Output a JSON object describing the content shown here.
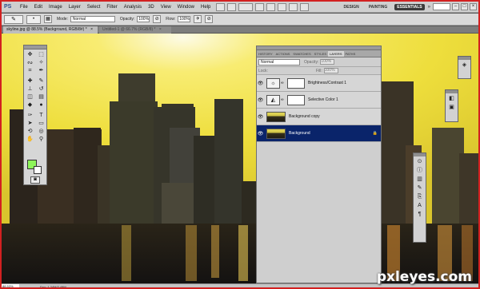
{
  "app": {
    "logo": "PS"
  },
  "menu": [
    "File",
    "Edit",
    "Image",
    "Layer",
    "Select",
    "Filter",
    "Analysis",
    "3D",
    "View",
    "Window",
    "Help"
  ],
  "menubar_icons": [
    "bridge-icon",
    "minibridge-icon",
    "zoom-level-icon",
    "hand-icon",
    "zoom-icon",
    "rotate-icon",
    "arrange-icon",
    "screen-mode-icon"
  ],
  "workspaces": {
    "design": "DESIGN",
    "painting": "PAINTING",
    "essentials": "ESSENTIALS",
    "more": "»"
  },
  "window_buttons": {
    "minimize": "–",
    "restore": "□",
    "close": "×"
  },
  "options": {
    "tool_glyph": "✎",
    "mode_label": "Mode:",
    "mode_value": "Normal",
    "opacity_label": "Opacity:",
    "opacity_value": "100%",
    "flow_label": "Flow:",
    "flow_value": "100%"
  },
  "tabs": [
    {
      "label": "skyline.jpg @ 88.5% (Background, RGB/8#) *",
      "close": "×"
    },
    {
      "label": "Untitled-1 @ 66.7% (RGB/8) *",
      "close": "×"
    }
  ],
  "toolbox": {
    "tools": [
      {
        "name": "move-tool",
        "glyph": "✥"
      },
      {
        "name": "marquee-tool",
        "glyph": "⬚"
      },
      {
        "name": "lasso-tool",
        "glyph": "ᔓ"
      },
      {
        "name": "quick-select-tool",
        "glyph": "✧"
      },
      {
        "name": "crop-tool",
        "glyph": "⌗"
      },
      {
        "name": "eyedropper-tool",
        "glyph": "✒"
      },
      {
        "name": "healing-brush-tool",
        "glyph": "✚"
      },
      {
        "name": "brush-tool",
        "glyph": "✎"
      },
      {
        "name": "clone-stamp-tool",
        "glyph": "⊥"
      },
      {
        "name": "history-brush-tool",
        "glyph": "↺"
      },
      {
        "name": "eraser-tool",
        "glyph": "◫"
      },
      {
        "name": "gradient-tool",
        "glyph": "▤"
      },
      {
        "name": "blur-tool",
        "glyph": "◆"
      },
      {
        "name": "dodge-tool",
        "glyph": "●"
      },
      {
        "name": "pen-tool",
        "glyph": "✑"
      },
      {
        "name": "type-tool",
        "glyph": "T"
      },
      {
        "name": "path-select-tool",
        "glyph": "➤"
      },
      {
        "name": "shape-tool",
        "glyph": "▭"
      },
      {
        "name": "3d-rotate-tool",
        "glyph": "⟲"
      },
      {
        "name": "3d-orbit-tool",
        "glyph": "◎"
      },
      {
        "name": "hand-tool",
        "glyph": "✋"
      },
      {
        "name": "zoom-tool",
        "glyph": "⚲"
      }
    ],
    "quickmask_glyph": "◙",
    "foreground_color": "#8ef55a",
    "background_color": "#ffffff"
  },
  "layers_panel": {
    "tabs": [
      "HISTORY",
      "ACTIONS",
      "SWATCHES",
      "STYLES",
      "LAYERS",
      "PATHS"
    ],
    "blend_mode": "Normal",
    "opacity_label": "Opacity:",
    "opacity_value": "100%",
    "lock_label": "Lock:",
    "fill_label": "Fill:",
    "fill_value": "100%",
    "layers": [
      {
        "name": "Brightness/Contrast 1",
        "type": "adjustment",
        "glyph": "☼",
        "visible_glyph": "👁",
        "selected": false
      },
      {
        "name": "Selective Color 1",
        "type": "adjustment",
        "glyph": "◭",
        "visible_glyph": "👁",
        "selected": false
      },
      {
        "name": "Background copy",
        "type": "image",
        "visible_glyph": "👁",
        "selected": false
      },
      {
        "name": "Background",
        "type": "image",
        "visible_glyph": "👁",
        "selected": true,
        "lock_glyph": "🔒"
      }
    ]
  },
  "docks": {
    "dock1": [
      "3d-icon"
    ],
    "dock2": [
      "color-icon",
      "adjustments-icon"
    ],
    "dock3": [
      "navigator-icon",
      "info-icon",
      "histogram-icon",
      "brush-presets-icon",
      "clone-source-icon",
      "character-icon",
      "paragraph-icon"
    ]
  },
  "dock_glyphs": {
    "3d-icon": "◈",
    "color-icon": "◧",
    "adjustments-icon": "▣",
    "navigator-icon": "⊙",
    "info-icon": "ⓘ",
    "histogram-icon": "▥",
    "brush-presets-icon": "✎",
    "clone-source-icon": "⎘",
    "character-icon": "A",
    "paragraph-icon": "¶"
  },
  "status": {
    "zoom": "88.53%",
    "doc_info": "Doc: 1.24M/2.48M"
  },
  "watermark": "pxleyes.com"
}
